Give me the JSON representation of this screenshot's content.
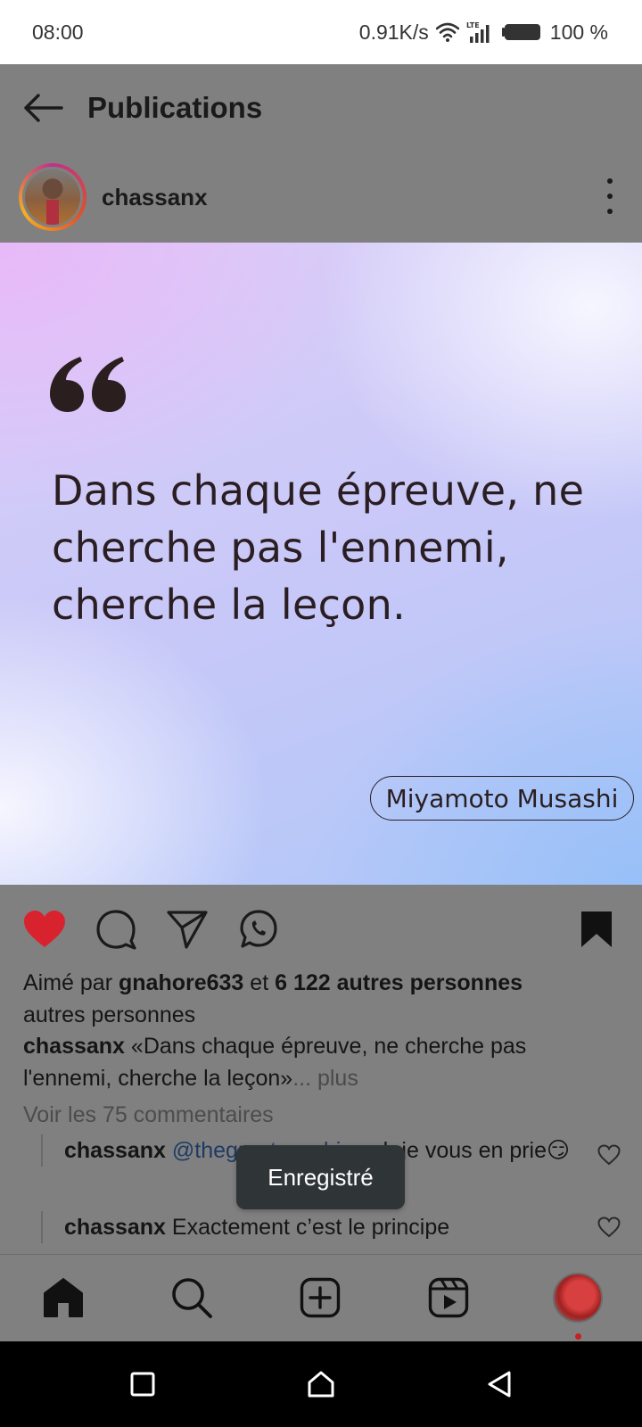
{
  "status_bar": {
    "time": "08:00",
    "network_speed": "0.91K/s",
    "signal_label": "LTE",
    "battery": "100 %"
  },
  "header": {
    "title": "Publications",
    "back_icon": "arrow-left-icon"
  },
  "post": {
    "username": "chassanx",
    "quote_mark": "“",
    "quote_text": "Dans chaque épreuve, ne cherche pas l'ennemi, cherche la leçon.",
    "quote_author": "Miyamoto Musashi",
    "liked": true,
    "saved": true,
    "colors": {
      "like": "#d8232e",
      "mention": "#1e3a64",
      "story_ring": [
        "#c0308a",
        "#e0502a",
        "#f5b020"
      ]
    }
  },
  "likes": {
    "prefix": "Aimé par",
    "user": "gnahore633",
    "connector": "et",
    "count_text": "6 122 autres personnes",
    "repeat_line": "autres personnes"
  },
  "caption": {
    "username": "chassanx",
    "text": "«Dans chaque épreuve, ne cherche pas l'ennemi, cherche la leçon»",
    "more": "... plus"
  },
  "view_comments": "Voir les 75 commentaires",
  "comments": [
    {
      "username": "chassanx",
      "mention": "@thegreatezechias",
      "text": " oh je vous en prie😏"
    },
    {
      "username": "chassanx",
      "mention": "",
      "text": " Exactement c’est le principe"
    }
  ],
  "toast": "Enregistré",
  "bottom_nav": [
    "home-icon",
    "search-icon",
    "add-post-icon",
    "reels-icon",
    "profile-avatar"
  ],
  "system_nav": [
    "recents-square-icon",
    "home-circle-icon",
    "back-triangle-icon"
  ]
}
